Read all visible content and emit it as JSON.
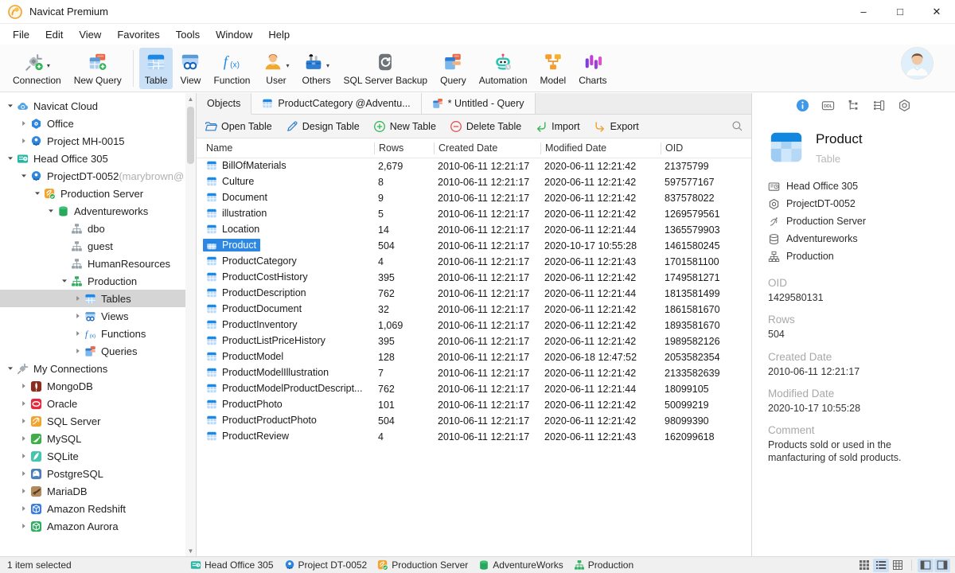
{
  "theme": {
    "accent_blue": "#2e87e0",
    "toolbar_selected_bg": "#c9e0f7",
    "tree_selected_bg": "#d5d5d5",
    "status_bg": "#f0f0f0"
  },
  "window": {
    "title": "Navicat Premium",
    "controls": [
      "minimize",
      "maximize",
      "close"
    ]
  },
  "menu": {
    "items": [
      "File",
      "Edit",
      "View",
      "Favorites",
      "Tools",
      "Window",
      "Help"
    ]
  },
  "toolbar": {
    "items": [
      {
        "label": "Connection",
        "icon": "tb-connection",
        "dropdown": true
      },
      {
        "label": "New Query",
        "icon": "tb-new-query",
        "sep_after": true
      },
      {
        "label": "Table",
        "icon": "tb-table",
        "active": true
      },
      {
        "label": "View",
        "icon": "tb-view"
      },
      {
        "label": "Function",
        "icon": "tb-function"
      },
      {
        "label": "User",
        "icon": "tb-user",
        "dropdown": true
      },
      {
        "label": "Others",
        "icon": "tb-others",
        "dropdown": true
      },
      {
        "label": "SQL Server Backup",
        "icon": "tb-backup"
      },
      {
        "label": "Query",
        "icon": "tb-query"
      },
      {
        "label": "Automation",
        "icon": "tb-automation"
      },
      {
        "label": "Model",
        "icon": "tb-model"
      },
      {
        "label": "Charts",
        "icon": "tb-charts"
      }
    ]
  },
  "sidebar": {
    "items": [
      {
        "indent": 0,
        "chevron": "down",
        "icon": "cloud",
        "label": "Navicat Cloud"
      },
      {
        "indent": 1,
        "chevron": "right",
        "icon": "office",
        "label": "Office"
      },
      {
        "indent": 1,
        "chevron": "right",
        "icon": "project",
        "label": "Project MH-0015"
      },
      {
        "indent": 0,
        "chevron": "down",
        "icon": "head-office",
        "label": "Head Office 305"
      },
      {
        "indent": 1,
        "chevron": "down",
        "icon": "project",
        "label": "ProjectDT-0052",
        "suffix": " (marybrown@"
      },
      {
        "indent": 2,
        "chevron": "down",
        "icon": "server-check",
        "label": "Production Server"
      },
      {
        "indent": 3,
        "chevron": "down",
        "icon": "database",
        "label": "Adventureworks"
      },
      {
        "indent": 4,
        "chevron": "none",
        "icon": "schema-gray",
        "label": "dbo"
      },
      {
        "indent": 4,
        "chevron": "none",
        "icon": "schema-gray",
        "label": "guest"
      },
      {
        "indent": 4,
        "chevron": "none",
        "icon": "schema-gray",
        "label": "HumanResources"
      },
      {
        "indent": 4,
        "chevron": "down",
        "icon": "schema-green",
        "label": "Production"
      },
      {
        "indent": 5,
        "chevron": "right",
        "icon": "table-sm",
        "label": "Tables",
        "selected": true
      },
      {
        "indent": 5,
        "chevron": "right",
        "icon": "view-sm",
        "label": "Views"
      },
      {
        "indent": 5,
        "chevron": "right",
        "icon": "fx-sm",
        "label": "Functions"
      },
      {
        "indent": 5,
        "chevron": "right",
        "icon": "query-sm",
        "label": "Queries"
      },
      {
        "indent": 0,
        "chevron": "down",
        "icon": "plug",
        "label": "My Connections"
      },
      {
        "indent": 1,
        "chevron": "right",
        "icon": "mongodb",
        "label": "MongoDB"
      },
      {
        "indent": 1,
        "chevron": "right",
        "icon": "oracle",
        "label": "Oracle"
      },
      {
        "indent": 1,
        "chevron": "right",
        "icon": "sqlserver",
        "label": "SQL Server"
      },
      {
        "indent": 1,
        "chevron": "right",
        "icon": "mysql",
        "label": "MySQL"
      },
      {
        "indent": 1,
        "chevron": "right",
        "icon": "sqlite",
        "label": "SQLite"
      },
      {
        "indent": 1,
        "chevron": "right",
        "icon": "postgresql",
        "label": "PostgreSQL"
      },
      {
        "indent": 1,
        "chevron": "right",
        "icon": "mariadb",
        "label": "MariaDB"
      },
      {
        "indent": 1,
        "chevron": "right",
        "icon": "redshift",
        "label": "Amazon Redshift"
      },
      {
        "indent": 1,
        "chevron": "right",
        "icon": "aurora",
        "label": "Amazon Aurora"
      }
    ]
  },
  "tabs": [
    {
      "label": "Objects",
      "active": true
    },
    {
      "label": "ProductCategory @Adventu...",
      "icon": "table-sm"
    },
    {
      "label": "* Untitled - Query",
      "icon": "query-sm"
    }
  ],
  "object_toolbar": {
    "buttons": [
      {
        "label": "Open Table",
        "icon": "open-folder"
      },
      {
        "label": "Design Table",
        "icon": "pencil"
      },
      {
        "label": "New Table",
        "icon": "plus-circle"
      },
      {
        "label": "Delete Table",
        "icon": "minus-circle"
      },
      {
        "label": "Import",
        "icon": "import-arrow"
      },
      {
        "label": "Export",
        "icon": "export-arrow"
      }
    ]
  },
  "table": {
    "columns": [
      "Name",
      "Rows",
      "Created Date",
      "Modified Date",
      "OID"
    ],
    "rows": [
      {
        "name": "BillOfMaterials",
        "rows": "2,679",
        "created": "2010-06-11 12:21:17",
        "modified": "2020-06-11 12:21:42",
        "oid": "21375799"
      },
      {
        "name": "Culture",
        "rows": "8",
        "created": "2010-06-11 12:21:17",
        "modified": "2020-06-11 12:21:42",
        "oid": "597577167"
      },
      {
        "name": "Document",
        "rows": "9",
        "created": "2010-06-11 12:21:17",
        "modified": "2020-06-11 12:21:42",
        "oid": "837578022"
      },
      {
        "name": "illustration",
        "rows": "5",
        "created": "2010-06-11 12:21:17",
        "modified": "2020-06-11 12:21:42",
        "oid": "1269579561"
      },
      {
        "name": "Location",
        "rows": "14",
        "created": "2010-06-11 12:21:17",
        "modified": "2020-06-11 12:21:44",
        "oid": "1365579903"
      },
      {
        "name": "Product",
        "selected": true,
        "rows": "504",
        "created": "2010-06-11 12:21:17",
        "modified": "2020-10-17 10:55:28",
        "oid": "1461580245"
      },
      {
        "name": "ProductCategory",
        "rows": "4",
        "created": "2010-06-11 12:21:17",
        "modified": "2020-06-11 12:21:43",
        "oid": "1701581100"
      },
      {
        "name": "ProductCostHistory",
        "rows": "395",
        "created": "2010-06-11 12:21:17",
        "modified": "2020-06-11 12:21:42",
        "oid": "1749581271"
      },
      {
        "name": "ProductDescription",
        "rows": "762",
        "created": "2010-06-11 12:21:17",
        "modified": "2020-06-11 12:21:44",
        "oid": "1813581499"
      },
      {
        "name": "ProductDocument",
        "rows": "32",
        "created": "2010-06-11 12:21:17",
        "modified": "2020-06-11 12:21:42",
        "oid": "1861581670"
      },
      {
        "name": "ProductInventory",
        "rows": "1,069",
        "created": "2010-06-11 12:21:17",
        "modified": "2020-06-11 12:21:42",
        "oid": "1893581670"
      },
      {
        "name": "ProductListPriceHistory",
        "rows": "395",
        "created": "2010-06-11 12:21:17",
        "modified": "2020-06-11 12:21:42",
        "oid": "1989582126"
      },
      {
        "name": "ProductModel",
        "rows": "128",
        "created": "2010-06-11 12:21:17",
        "modified": "2020-06-18 12:47:52",
        "oid": "2053582354"
      },
      {
        "name": "ProductModelIllustration",
        "rows": "7",
        "created": "2010-06-11 12:21:17",
        "modified": "2020-06-11 12:21:42",
        "oid": "2133582639"
      },
      {
        "name": "ProductModelProductDescript...",
        "rows": "762",
        "created": "2010-06-11 12:21:17",
        "modified": "2020-06-11 12:21:44",
        "oid": "18099105"
      },
      {
        "name": "ProductPhoto",
        "rows": "101",
        "created": "2010-06-11 12:21:17",
        "modified": "2020-06-11 12:21:42",
        "oid": "50099219"
      },
      {
        "name": "ProductProductPhoto",
        "rows": "504",
        "created": "2010-06-11 12:21:17",
        "modified": "2020-06-11 12:21:42",
        "oid": "98099390"
      },
      {
        "name": "ProductReview",
        "rows": "4",
        "created": "2010-06-11 12:21:17",
        "modified": "2020-06-11 12:21:43",
        "oid": "162099618"
      }
    ]
  },
  "details": {
    "panel_icons": [
      "info",
      "ddl",
      "structure",
      "relation",
      "nut"
    ],
    "title": "Product",
    "subtitle": "Table",
    "breadcrumbs": [
      {
        "icon": "bc-office",
        "label": "Head Office 305"
      },
      {
        "icon": "bc-hexnut",
        "label": "ProjectDT-0052"
      },
      {
        "icon": "bc-server",
        "label": "Production Server"
      },
      {
        "icon": "bc-database",
        "label": "Adventureworks"
      },
      {
        "icon": "bc-schema",
        "label": "Production"
      }
    ],
    "fields": [
      {
        "label": "OID",
        "value": "1429580131"
      },
      {
        "label": "Rows",
        "value": "504"
      },
      {
        "label": "Created Date",
        "value": "2010-06-11 12:21:17"
      },
      {
        "label": "Modified Date",
        "value": "2020-10-17 10:55:28"
      },
      {
        "label": "Comment",
        "value": "Products sold or used in the manfacturing of sold products."
      }
    ]
  },
  "status_bar": {
    "left": "1 item selected",
    "items": [
      {
        "icon": "head-office",
        "label": "Head Office 305"
      },
      {
        "icon": "project",
        "label": "Project DT-0052"
      },
      {
        "icon": "server-check",
        "label": "Production Server"
      },
      {
        "icon": "database",
        "label": "AdventureWorks"
      },
      {
        "icon": "schema-green",
        "label": "Production"
      }
    ],
    "view_buttons": [
      {
        "icon": "sb-grid",
        "name": "grid-view",
        "on": false
      },
      {
        "icon": "sb-list",
        "name": "list-view",
        "on": true
      },
      {
        "icon": "sb-detail",
        "name": "detail-view",
        "on": false
      },
      {
        "icon": "sb-pane-left",
        "name": "toggle-left-pane",
        "on": true
      },
      {
        "icon": "sb-pane-right",
        "name": "toggle-right-pane",
        "on": true
      }
    ]
  }
}
